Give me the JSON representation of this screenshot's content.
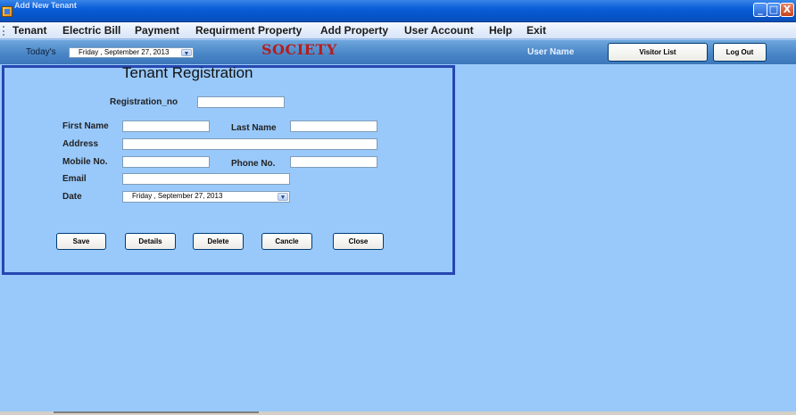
{
  "window": {
    "title": "Add New Tenant",
    "buttons": {
      "minimize": "_",
      "maximize": "□",
      "close": "X"
    }
  },
  "menu": [
    "Tenant",
    "Electric Bill",
    "Payment",
    "Requirment Property",
    "Add Property",
    "User Account",
    "Help",
    "Exit"
  ],
  "toolbar": {
    "todays_label": "Today's",
    "date_value": "Friday    , September 27, 2013",
    "brand": "SOCIETY",
    "user_name": "User Name",
    "visitor_list": "Visitor List",
    "log_out": "Log Out"
  },
  "form": {
    "title": "Tenant Registration",
    "labels": {
      "registration_no": "Registration_no",
      "first_name": "First Name",
      "last_name": "Last Name",
      "address": "Address",
      "mobile_no": "Mobile No.",
      "phone_no": "Phone No.",
      "email": "Email",
      "date": "Date"
    },
    "values": {
      "registration_no": "",
      "first_name": "",
      "last_name": "",
      "address": "",
      "mobile_no": "",
      "phone_no": "",
      "email": "",
      "date": "Friday     , September 27, 2013"
    },
    "buttons": {
      "save": "Save",
      "details": "Details",
      "delete": "Delete",
      "cancel": "Cancle",
      "close": "Close"
    }
  },
  "colors": {
    "background": "#99c9fb",
    "panel_border": "#2646b0",
    "brand": "#b51d1d"
  }
}
